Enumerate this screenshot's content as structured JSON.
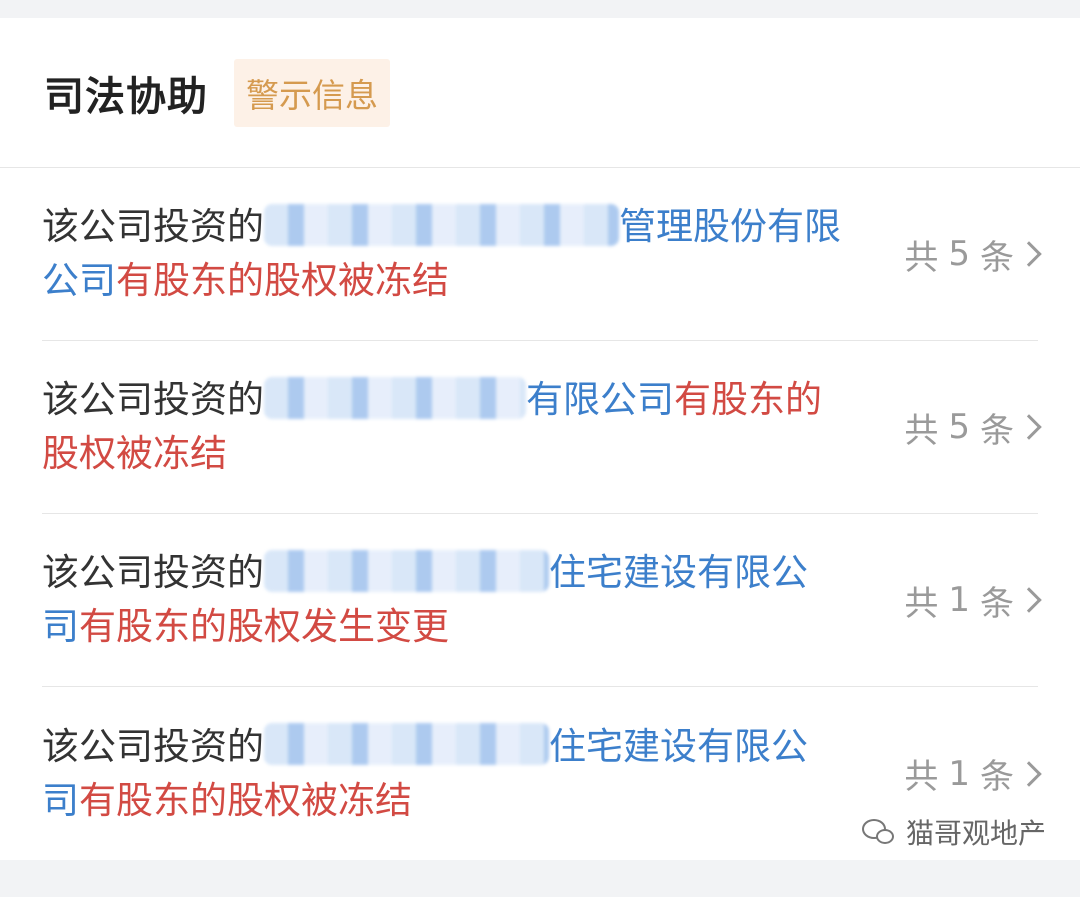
{
  "header": {
    "title": "司法协助",
    "badge": "警示信息"
  },
  "rows": [
    {
      "prefix": "该公司投资的",
      "company_visible": "管理股份有限公司",
      "event": "有股东的股权被冻结",
      "count_prefix": "共",
      "count": "5",
      "count_suffix": "条"
    },
    {
      "prefix": "该公司投资的",
      "company_visible": "有限公司",
      "event": "有股东的股权被冻结",
      "count_prefix": "共",
      "count": "5",
      "count_suffix": "条"
    },
    {
      "prefix": "该公司投资的",
      "company_visible": "住宅建设有限公司",
      "event": "有股东的股权发生变更",
      "count_prefix": "共",
      "count": "1",
      "count_suffix": "条"
    },
    {
      "prefix": "该公司投资的",
      "company_visible": "住宅建设有限公司",
      "event": "有股东的股权被冻结",
      "count_prefix": "共",
      "count": "1",
      "count_suffix": "条"
    }
  ],
  "watermark": {
    "text": "猫哥观地产",
    "icon": "wechat-icon"
  },
  "colors": {
    "company_link": "#3c7fcb",
    "event_alert": "#d24a43",
    "badge_text": "#d59a4f",
    "badge_bg": "#fdf1e7"
  }
}
